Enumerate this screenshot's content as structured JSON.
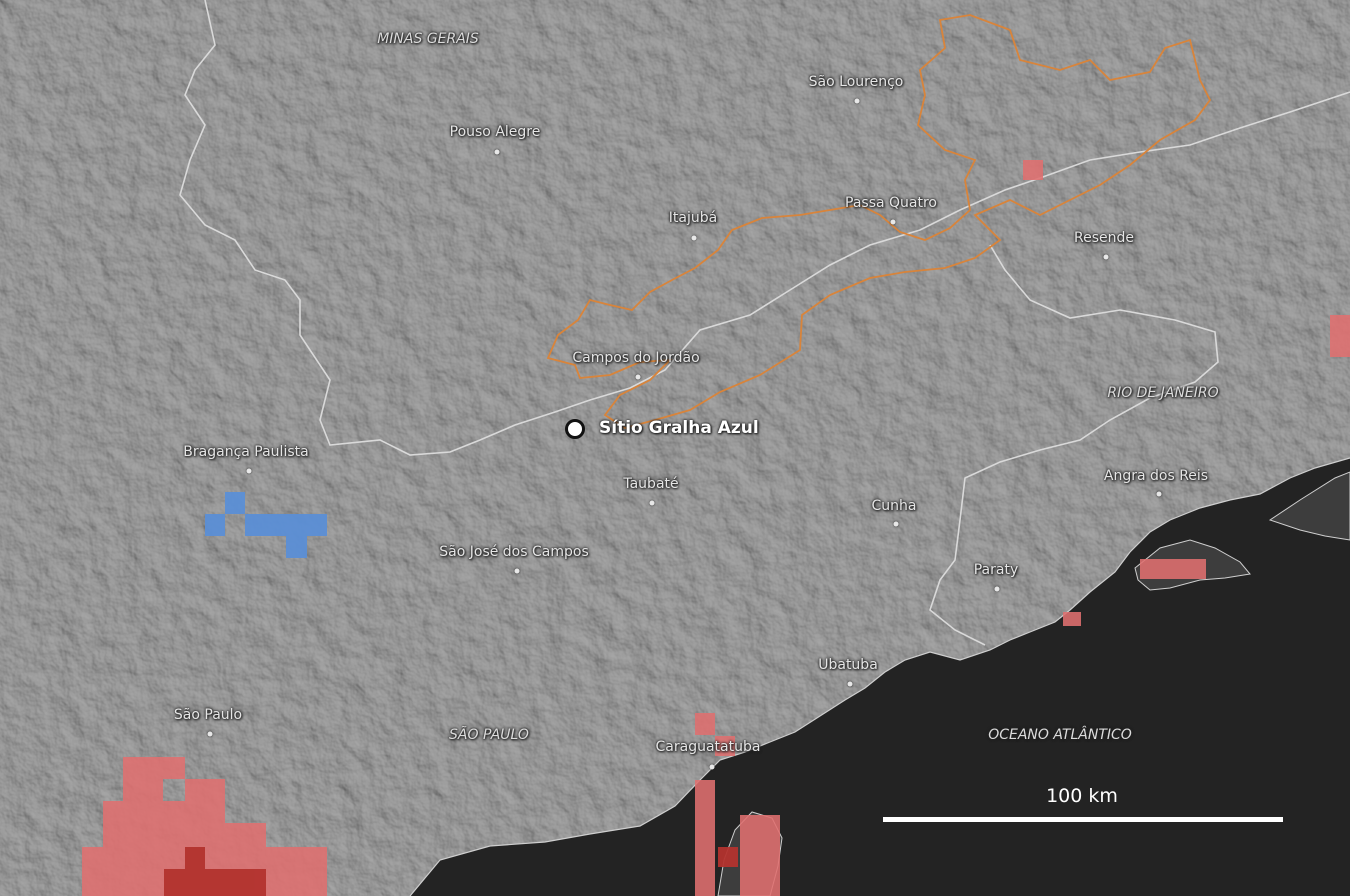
{
  "map": {
    "colors": {
      "land": "#4a4a4a",
      "ocean": "#232323",
      "state_border": "#d9d9d9",
      "park_outline": "#d9843a",
      "cell_light_red": "#e07070",
      "cell_dark_red": "#b3332e",
      "cell_blue": "#5b8fd6"
    },
    "states": [
      {
        "name": "MINAS GERAIS"
      },
      {
        "name": "SÃO PAULO"
      },
      {
        "name": "RIO DE JANEIRO"
      }
    ],
    "ocean_label": "OCEANO ATLÂNTICO",
    "cities": [
      {
        "name": "São Lourenço"
      },
      {
        "name": "Pouso Alegre"
      },
      {
        "name": "Itajubá"
      },
      {
        "name": "Passa Quatro"
      },
      {
        "name": "Resende"
      },
      {
        "name": "Campos do Jordão"
      },
      {
        "name": "Bragança Paulista"
      },
      {
        "name": "Taubaté"
      },
      {
        "name": "Angra dos Reis"
      },
      {
        "name": "Cunha"
      },
      {
        "name": "São José dos Campos"
      },
      {
        "name": "Paraty"
      },
      {
        "name": "Ubatuba"
      },
      {
        "name": "São Paulo"
      },
      {
        "name": "Caraguatatuba"
      }
    ],
    "site": {
      "name": "Sítio Gralha Azul"
    },
    "scale": {
      "label": "100 km"
    }
  }
}
